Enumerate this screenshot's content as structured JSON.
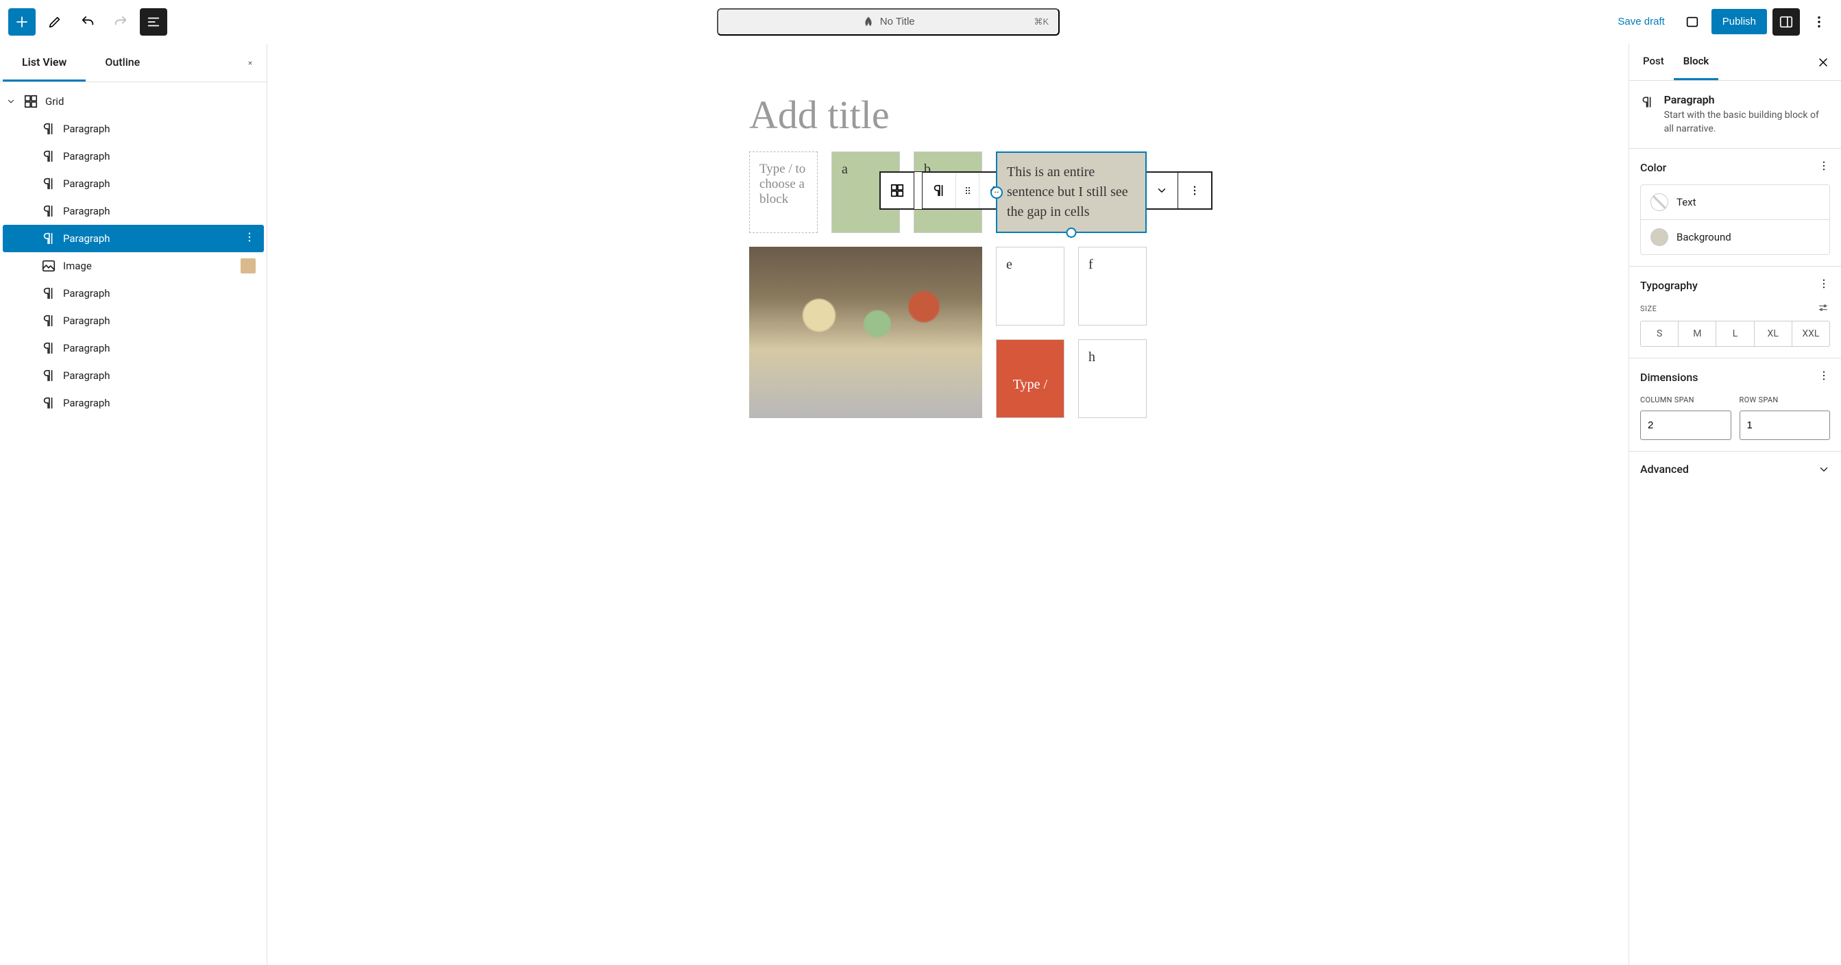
{
  "topbar": {
    "doc_title": "No Title",
    "keyboard_shortcut": "⌘K",
    "save_draft": "Save draft",
    "publish": "Publish"
  },
  "left_panel": {
    "tabs": {
      "list_view": "List View",
      "outline": "Outline"
    },
    "tree": {
      "root": "Grid",
      "children": [
        {
          "label": "Paragraph"
        },
        {
          "label": "Paragraph"
        },
        {
          "label": "Paragraph"
        },
        {
          "label": "Paragraph"
        },
        {
          "label": "Paragraph",
          "selected": true
        },
        {
          "label": "Image",
          "thumb": true
        },
        {
          "label": "Paragraph"
        },
        {
          "label": "Paragraph"
        },
        {
          "label": "Paragraph"
        },
        {
          "label": "Paragraph"
        },
        {
          "label": "Paragraph"
        }
      ]
    }
  },
  "canvas": {
    "title_placeholder": "Add title",
    "cells": {
      "placeholder1": "Type / to choose a block",
      "a": "a",
      "b": "b",
      "sentence": "This is an entire sentence but I still see the gap in cells",
      "e": "e",
      "f": "f",
      "h": "h",
      "orange": "Type /"
    }
  },
  "right_panel": {
    "tabs": {
      "post": "Post",
      "block": "Block"
    },
    "block": {
      "title": "Paragraph",
      "desc": "Start with the basic building block of all narrative."
    },
    "color": {
      "title": "Color",
      "text": "Text",
      "background": "Background"
    },
    "typography": {
      "title": "Typography",
      "size_label": "SIZE",
      "sizes": [
        "S",
        "M",
        "L",
        "XL",
        "XXL"
      ]
    },
    "dimensions": {
      "title": "Dimensions",
      "col_span_label": "COLUMN SPAN",
      "row_span_label": "ROW SPAN",
      "col_span": "2",
      "row_span": "1"
    },
    "advanced": "Advanced"
  }
}
